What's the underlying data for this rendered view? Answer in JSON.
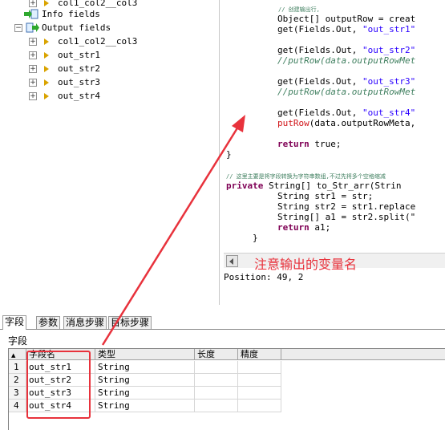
{
  "tree": {
    "cut_item": "col1_col2__col3",
    "info_fields": "Info fields",
    "output_fields": "Output fields",
    "items": [
      "col1_col2__col3",
      "out_str1",
      "out_str2",
      "out_str3",
      "out_str4"
    ],
    "expander": "+",
    "collapser": "−"
  },
  "code": {
    "l0": "// 创建输出行,",
    "l1a": "Object[] outputRow = creat",
    "l2a": "get(Fields.Out, ",
    "l2s": "\"out_str1\"",
    "l3a": "get(Fields.Out, ",
    "l3s": "\"out_str2\"",
    "l4": "//putRow(data.outputRowMet",
    "l5a": "get(Fields.Out, ",
    "l5s": "\"out_str3\"",
    "l6": "//putRow(data.outputRowMet",
    "l7a": "get(Fields.Out, ",
    "l7s": "\"out_str4\"",
    "l8a": "putRow",
    "l8b": "(data.outputRowMeta,",
    "l9k": "return",
    "l9v": " true;",
    "l10": "}",
    "l11": "// 这里主要是将字段转换为字符串数组,不过先将多个空格缩减",
    "l12k": "private",
    "l12v": " String[] to_Str_arr(Strin",
    "l13": "String str1 = str;",
    "l14": "String str2 = str1.replace",
    "l15": "String[] a1 = str2.split(\"",
    "l16k": "return",
    "l16v": " a1;",
    "l17": "}"
  },
  "annotation": "注意输出的变量名",
  "position": "Position: 49, 2",
  "tabs": [
    "字段",
    "参数",
    "消息步骤",
    "目标步骤"
  ],
  "section_title": "字段",
  "grid": {
    "headers": [
      "字段名",
      "类型",
      "长度",
      "精度"
    ],
    "rows": [
      {
        "n": "1",
        "name": "out_str1",
        "type": "String"
      },
      {
        "n": "2",
        "name": "out_str2",
        "type": "String"
      },
      {
        "n": "3",
        "name": "out_str3",
        "type": "String"
      },
      {
        "n": "4",
        "name": "out_str4",
        "type": "String"
      }
    ]
  },
  "colors": {
    "annotation_red": "#e8323c",
    "keyword": "#7f0055",
    "string": "#2a00ff",
    "comment": "#3f7f5f"
  }
}
